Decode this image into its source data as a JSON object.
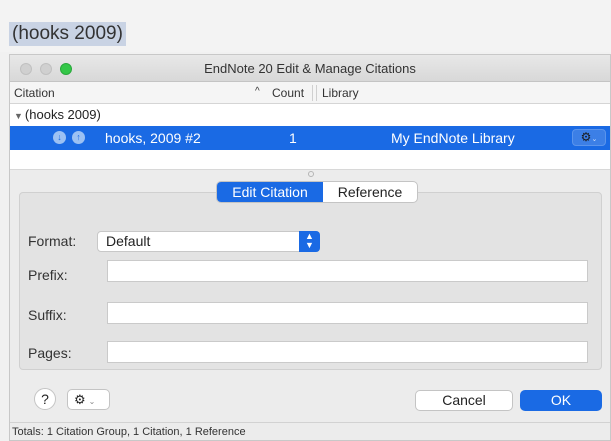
{
  "document": {
    "citation_text": "(hooks 2009)"
  },
  "window": {
    "title": "EndNote 20 Edit & Manage Citations"
  },
  "columns": {
    "citation": "Citation",
    "sort_indicator": "^",
    "count": "Count",
    "library": "Library"
  },
  "citations": {
    "group_label": "(hooks 2009)",
    "selected": {
      "reference": "hooks, 2009 #2",
      "count": "1",
      "library": "My EndNote Library"
    }
  },
  "tabs": {
    "edit_citation": "Edit Citation",
    "reference": "Reference",
    "active": "Edit Citation"
  },
  "form": {
    "format_label": "Format:",
    "format_value": "Default",
    "prefix_label": "Prefix:",
    "prefix_value": "",
    "suffix_label": "Suffix:",
    "suffix_value": "",
    "pages_label": "Pages:",
    "pages_value": ""
  },
  "buttons": {
    "help": "?",
    "cancel": "Cancel",
    "ok": "OK"
  },
  "status": {
    "totals": "Totals: 1 Citation Group, 1 Citation, 1 Reference"
  },
  "colors": {
    "accent": "#1a6ae4",
    "selection": "#1a6ae4",
    "zoom": "#34c748"
  },
  "icons": [
    "disclosure-triangle-icon",
    "move-down-icon",
    "move-up-icon",
    "gear-icon",
    "chevron-down-icon",
    "stepper-icon"
  ]
}
